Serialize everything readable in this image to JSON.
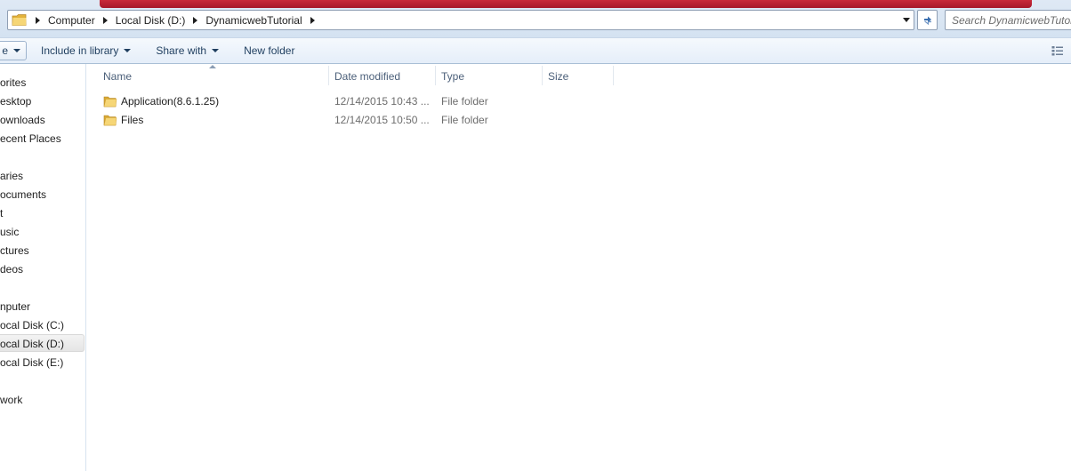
{
  "address_bar": {
    "crumbs": [
      "Computer",
      "Local Disk (D:)",
      "DynamicwebTutorial"
    ]
  },
  "search": {
    "placeholder": "Search DynamicwebTutorial"
  },
  "toolbar": {
    "organize_label": "e",
    "include_label": "Include in library",
    "share_label": "Share with",
    "new_folder_label": "New folder"
  },
  "nav": {
    "items": [
      "orites",
      "esktop",
      "ownloads",
      "ecent Places",
      "aries",
      "ocuments",
      "t",
      "usic",
      "ctures",
      "deos",
      "nputer",
      "ocal Disk (C:)",
      "ocal Disk (D:)",
      "ocal Disk (E:)",
      "work"
    ],
    "selected_index": 12
  },
  "columns": {
    "name": "Name",
    "date": "Date modified",
    "type": "Type",
    "size": "Size"
  },
  "files": [
    {
      "name": "Application(8.6.1.25)",
      "date": "12/14/2015 10:43 ...",
      "type": "File folder",
      "size": ""
    },
    {
      "name": "Files",
      "date": "12/14/2015 10:50 ...",
      "type": "File folder",
      "size": ""
    }
  ],
  "colors": {
    "folder_yellow": "#f2cc5b",
    "accent_blue": "#1e3d5e"
  }
}
